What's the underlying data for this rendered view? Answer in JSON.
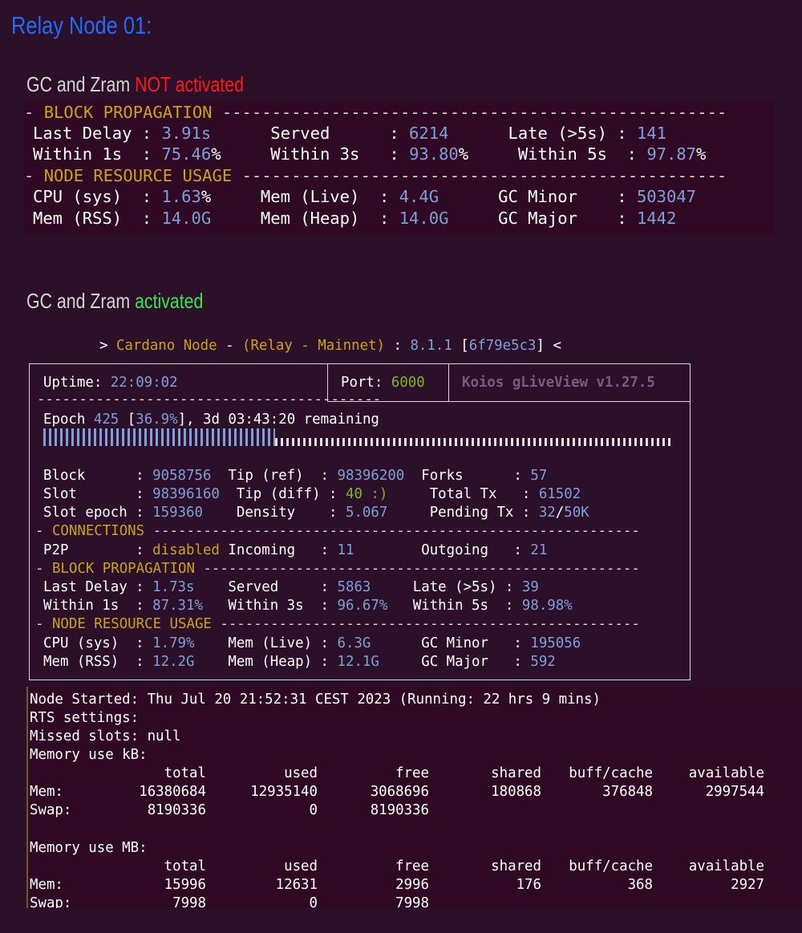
{
  "title": "Relay Node 01:",
  "section1": {
    "heading_prefix": "GC and Zram ",
    "heading_status": "NOT activated",
    "block_propagation_label": "BLOCK PROPAGATION",
    "node_resource_label": "NODE RESOURCE USAGE",
    "last_delay_label": "Last Delay",
    "last_delay": "3.91s",
    "served_label": "Served",
    "served": "6214",
    "late_label": "Late (>5s)",
    "late": "141",
    "within1_label": "Within 1s",
    "within1": "75.46",
    "within3_label": "Within 3s",
    "within3": "93.80",
    "within5_label": "Within 5s",
    "within5": "97.87",
    "cpu_label": "CPU (sys)",
    "cpu": "1.63",
    "mem_live_label": "Mem (Live)",
    "mem_live": "4.4G",
    "gc_minor_label": "GC Minor",
    "gc_minor": "503047",
    "mem_rss_label": "Mem (RSS)",
    "mem_rss": "14.0G",
    "mem_heap_label": "Mem (Heap)",
    "mem_heap": "14.0G",
    "gc_major_label": "GC Major",
    "gc_major": "1442"
  },
  "section2": {
    "heading_prefix": "GC and Zram ",
    "heading_status": "activated",
    "header_prompt": "> ",
    "node_name": "Cardano Node",
    "dash1": " - ",
    "relay": "(Relay - Mainnet)",
    "colon": " : ",
    "version": "8.1.1",
    "commit": "6f79e5c3",
    "suffix": " <",
    "uptime_label": "Uptime:",
    "uptime": "22:09:02",
    "port_label": "Port:",
    "port": "6000",
    "app_name": "Koios gLiveView v1.27.5",
    "epoch_label": "Epoch",
    "epoch": "425",
    "epoch_pct": "36.9%",
    "epoch_progress": 0.369,
    "epoch_remaining": "3d 03:43:20",
    "remaining_label": "remaining",
    "block_label": "Block",
    "block": "9058756",
    "tip_ref_label": "Tip (ref)",
    "tip_ref": "98396200",
    "forks_label": "Forks",
    "forks": "57",
    "slot_label": "Slot",
    "slot": "98396160",
    "tip_diff_label": "Tip (diff)",
    "tip_diff": "40 :)",
    "total_tx_label": "Total Tx",
    "total_tx": "61502",
    "slot_epoch_label": "Slot epoch",
    "slot_epoch": "159360",
    "density_label": "Density",
    "density": "5.067",
    "pending_tx_label": "Pending Tx",
    "pending_tx": "32",
    "pending_tx_max": "50K",
    "connections_label": "CONNECTIONS",
    "p2p_label": "P2P",
    "p2p": "disabled",
    "incoming_label": "Incoming",
    "incoming": "11",
    "outgoing_label": "Outgoing",
    "outgoing": "21",
    "block_propagation_label": "BLOCK PROPAGATION",
    "last_delay_label": "Last Delay",
    "last_delay": "1.73s",
    "served_label": "Served",
    "served": "5863",
    "late_label": "Late (>5s)",
    "late": "39",
    "within1_label": "Within 1s",
    "within1": "87.31%",
    "within3_label": "Within 3s",
    "within3": "96.67%",
    "within5_label": "Within 5s",
    "within5": "98.98%",
    "node_resource_label": "NODE RESOURCE USAGE",
    "cpu_label": "CPU (sys)",
    "cpu": "1.79%",
    "mem_live_label": "Mem (Live)",
    "mem_live": "6.3G",
    "gc_minor_label": "GC Minor",
    "gc_minor": "195056",
    "mem_rss_label": "Mem (RSS)",
    "mem_rss": "12.2G",
    "mem_heap_label": "Mem (Heap)",
    "mem_heap": "12.1G",
    "gc_major_label": "GC Major",
    "gc_major": "592"
  },
  "section3": {
    "node_started": "Node Started: Thu Jul 20 21:52:31 CEST 2023 (Running: 22 hrs 9 mins)",
    "rts_settings": "RTS settings:",
    "missed_slots": "Missed slots: null",
    "mem_kb_label": "Memory use kB:",
    "mem_mb_label": "Memory use MB:",
    "columns": [
      "total",
      "used",
      "free",
      "shared",
      "buff/cache",
      "available"
    ],
    "kb_rows": [
      {
        "name": "Mem:",
        "values": [
          "16380684",
          "12935140",
          "3068696",
          "180868",
          "376848",
          "2997544"
        ]
      },
      {
        "name": "Swap:",
        "values": [
          "8190336",
          "0",
          "8190336",
          "",
          "",
          ""
        ]
      }
    ],
    "mb_rows": [
      {
        "name": "Mem:",
        "values": [
          "15996",
          "12631",
          "2996",
          "176",
          "368",
          "2927"
        ]
      },
      {
        "name": "Swap:",
        "values": [
          "7998",
          "0",
          "7998",
          "",
          "",
          ""
        ]
      }
    ]
  },
  "colors": {
    "background": "#2c0f29",
    "title_blue": "#1f6cf5",
    "not_red": "#ff1a1a",
    "activated_green": "#33e84a",
    "terminal_yellow": "#c8a31e",
    "terminal_blue": "#7f9fd6",
    "terminal_green": "#7eb52e"
  }
}
